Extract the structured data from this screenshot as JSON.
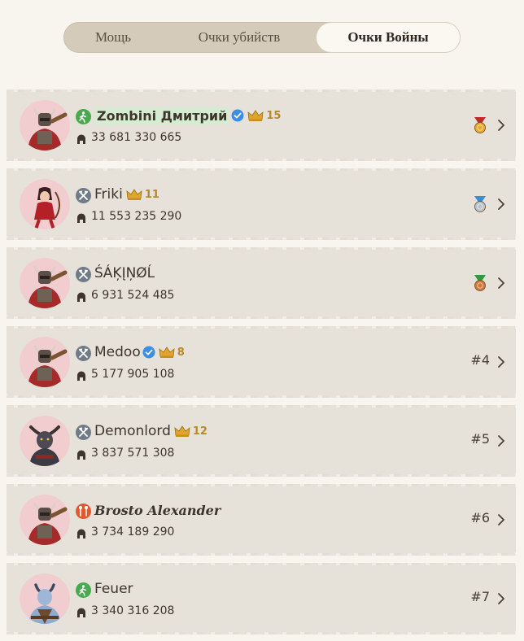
{
  "tabs": [
    {
      "label": "Мощь"
    },
    {
      "label": "Очки убийств"
    },
    {
      "label": "Очки Войны",
      "selected": true
    }
  ],
  "rows": [
    {
      "name": "Zombini Дмитрий",
      "verified": true,
      "highlight": true,
      "crown_level": "15",
      "power": "33 681 330 665",
      "class_icon": "archer-icon",
      "class_color": "#4aa84f",
      "rank": "",
      "medal": "gold-medal-icon",
      "avatar": "horned-warrior-avatar"
    },
    {
      "name": "Friki",
      "verified": false,
      "crown_level": "11",
      "power": "11 553 235 290",
      "class_icon": "warrior-axes-icon",
      "class_color": "#6f7b86",
      "rank": "",
      "medal": "silver-medal-icon",
      "avatar": "red-dress-archer-avatar"
    },
    {
      "name": "ŚÁĶĮŅØĹ",
      "verified": false,
      "crown_level": "",
      "power": "6 931 524 485",
      "class_icon": "warrior-axes-icon",
      "class_color": "#6f7b86",
      "rank": "",
      "medal": "bronze-medal-icon",
      "avatar": "horned-warrior-avatar"
    },
    {
      "name": "Medoo",
      "verified": true,
      "crown_level": "8",
      "power": "5 177 905 108",
      "class_icon": "warrior-axes-icon",
      "class_color": "#6f7b86",
      "rank": "#4",
      "medal": "",
      "avatar": "horned-warrior-avatar"
    },
    {
      "name": "Demonlord",
      "verified": false,
      "crown_level": "12",
      "power": "3 837 571 308",
      "class_icon": "warrior-axes-icon",
      "class_color": "#6f7b86",
      "rank": "#5",
      "medal": "",
      "avatar": "dark-minotaur-avatar"
    },
    {
      "name": "Brosto Alexander",
      "verified": false,
      "crown_level": "",
      "power": "3 734 189 290",
      "class_icon": "mage-staff-icon",
      "class_color": "#e2582f",
      "rank": "#6",
      "medal": "",
      "avatar": "horned-warrior-avatar"
    },
    {
      "name": "Feuer",
      "verified": false,
      "crown_level": "",
      "power": "3 340 316 208",
      "class_icon": "archer-icon",
      "class_color": "#4aa84f",
      "rank": "#7",
      "medal": "",
      "avatar": "blue-demon-avatar"
    }
  ]
}
